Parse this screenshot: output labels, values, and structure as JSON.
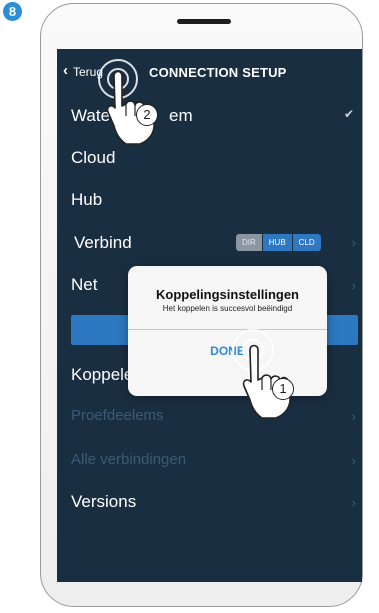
{
  "step_number": "8",
  "nav": {
    "back_label": "Terug",
    "title": "CONNECTION SETUP"
  },
  "menu": {
    "item_water": "Wate",
    "item_water_tail": "em",
    "item_cloud": "Cloud",
    "item_hub": "Hub",
    "item_verbind": "Verbind",
    "item_net": "Net",
    "item_koppelen": "Koppelen",
    "item_hidden_1": "Proefdeelems",
    "item_hidden_2": "Alle verbindingen",
    "item_versions": "Versions"
  },
  "segmented": {
    "options": [
      "DIR",
      "HUB",
      "CLD"
    ],
    "selected": "DIR"
  },
  "dialog": {
    "title": "Koppelingsinstellingen",
    "message": "Het koppelen is succesvol beëindigd",
    "button": "DONE"
  },
  "callouts": {
    "first": "1",
    "second": "2"
  },
  "colors": {
    "screen_bg": "#1a2e42",
    "accent_blue": "#2d78c0",
    "badge_blue": "#2b8fd8"
  }
}
